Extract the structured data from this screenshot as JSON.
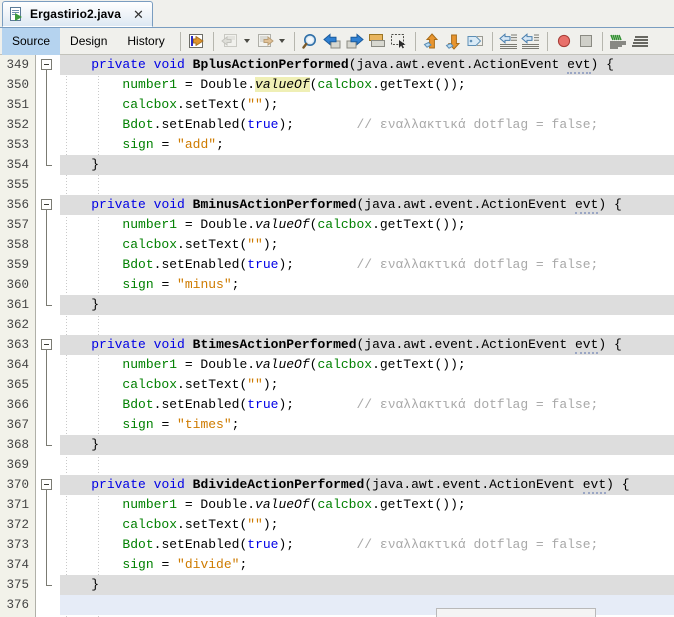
{
  "window": {
    "tab": {
      "title": "Ergastirio2.java",
      "icon": "java-file-icon",
      "close_label": "✕"
    }
  },
  "view_tabs": [
    {
      "label": "Source",
      "selected": true
    },
    {
      "label": "Design",
      "selected": false
    },
    {
      "label": "History",
      "selected": false
    }
  ],
  "toolbar": {
    "groups": [
      {
        "items": [
          {
            "name": "last-edit-icon",
            "kind": "last-edit"
          }
        ]
      },
      {
        "items": [
          {
            "name": "back-icon",
            "kind": "back",
            "disabled": true
          },
          {
            "name": "back-dropdown-icon",
            "kind": "caret"
          },
          {
            "name": "forward-icon",
            "kind": "forward",
            "disabled": true
          },
          {
            "name": "forward-dropdown-icon",
            "kind": "caret"
          }
        ]
      },
      {
        "items": [
          {
            "name": "find-selection-icon",
            "kind": "magnifier"
          },
          {
            "name": "find-previous-icon",
            "kind": "arrow-left-blue"
          },
          {
            "name": "find-next-icon",
            "kind": "arrow-right-blue"
          },
          {
            "name": "toggle-highlight-icon",
            "kind": "highlight"
          },
          {
            "name": "toggle-rectangular-selection-icon",
            "kind": "rect-select"
          }
        ]
      },
      {
        "items": [
          {
            "name": "previous-bookmark-icon",
            "kind": "arrow-up-orange"
          },
          {
            "name": "next-bookmark-icon",
            "kind": "arrow-down-orange"
          },
          {
            "name": "toggle-bookmark-icon",
            "kind": "bookmark-tag"
          }
        ]
      },
      {
        "items": [
          {
            "name": "shift-line-left-icon",
            "kind": "shift-left"
          },
          {
            "name": "shift-line-right-icon",
            "kind": "shift-right"
          }
        ]
      },
      {
        "items": [
          {
            "name": "toggle-breakpoint-icon",
            "kind": "breakpoint-red"
          },
          {
            "name": "stop-icon",
            "kind": "stop-grey"
          }
        ]
      },
      {
        "items": [
          {
            "name": "inspect-members-icon",
            "kind": "members-green"
          },
          {
            "name": "inspect-hierarchy-icon",
            "kind": "hierarchy-dark"
          }
        ]
      }
    ]
  },
  "editor": {
    "first_line": 349,
    "current_line": 376,
    "highlight_token": "valueOf",
    "folds": [
      {
        "start": 349,
        "end": 354
      },
      {
        "start": 356,
        "end": 361
      },
      {
        "start": 363,
        "end": 368
      },
      {
        "start": 370,
        "end": 375
      }
    ],
    "lines": [
      {
        "n": 349,
        "hl": true,
        "cur": false,
        "indent": 4,
        "tokens": [
          {
            "t": "private",
            "c": "kw"
          },
          {
            "t": " ",
            "c": ""
          },
          {
            "t": "void",
            "c": "kw"
          },
          {
            "t": " ",
            "c": ""
          },
          {
            "t": "BplusActionPerformed",
            "c": "bold"
          },
          {
            "t": "(java.awt.event.ActionEvent ",
            "c": ""
          },
          {
            "t": "evt",
            "c": "sq"
          },
          {
            "t": ") {",
            "c": ""
          }
        ]
      },
      {
        "n": 350,
        "hl": false,
        "cur": false,
        "indent": 8,
        "tokens": [
          {
            "t": "number1",
            "c": "id"
          },
          {
            "t": " = ",
            "c": ""
          },
          {
            "t": "Double",
            "c": ""
          },
          {
            "t": ".",
            "c": ""
          },
          {
            "t": "valueOf",
            "c": "mark"
          },
          {
            "t": "(",
            "c": ""
          },
          {
            "t": "calcbox",
            "c": "id"
          },
          {
            "t": ".getText());",
            "c": ""
          }
        ]
      },
      {
        "n": 351,
        "hl": false,
        "cur": false,
        "indent": 8,
        "tokens": [
          {
            "t": "calcbox",
            "c": "id"
          },
          {
            "t": ".setText(",
            "c": ""
          },
          {
            "t": "\"\"",
            "c": "str"
          },
          {
            "t": ");",
            "c": ""
          }
        ]
      },
      {
        "n": 352,
        "hl": false,
        "cur": false,
        "indent": 8,
        "tokens": [
          {
            "t": "Bdot",
            "c": "id"
          },
          {
            "t": ".setEnabled(",
            "c": ""
          },
          {
            "t": "true",
            "c": "kw"
          },
          {
            "t": ");",
            "c": ""
          },
          {
            "t": "        ",
            "c": ""
          },
          {
            "t": "// εναλλακτικά dotflag = false;",
            "c": "cmt"
          }
        ]
      },
      {
        "n": 353,
        "hl": false,
        "cur": false,
        "indent": 8,
        "tokens": [
          {
            "t": "sign",
            "c": "id"
          },
          {
            "t": " = ",
            "c": ""
          },
          {
            "t": "\"add\"",
            "c": "str"
          },
          {
            "t": ";",
            "c": ""
          }
        ]
      },
      {
        "n": 354,
        "hl": true,
        "cur": false,
        "indent": 4,
        "tokens": [
          {
            "t": "}",
            "c": ""
          }
        ]
      },
      {
        "n": 355,
        "hl": false,
        "cur": false,
        "indent": 0,
        "tokens": []
      },
      {
        "n": 356,
        "hl": true,
        "cur": false,
        "indent": 4,
        "tokens": [
          {
            "t": "private",
            "c": "kw"
          },
          {
            "t": " ",
            "c": ""
          },
          {
            "t": "void",
            "c": "kw"
          },
          {
            "t": " ",
            "c": ""
          },
          {
            "t": "BminusActionPerformed",
            "c": "bold"
          },
          {
            "t": "(java.awt.event.ActionEvent ",
            "c": ""
          },
          {
            "t": "evt",
            "c": "sq"
          },
          {
            "t": ") {",
            "c": ""
          }
        ]
      },
      {
        "n": 357,
        "hl": false,
        "cur": false,
        "indent": 8,
        "tokens": [
          {
            "t": "number1",
            "c": "id"
          },
          {
            "t": " = ",
            "c": ""
          },
          {
            "t": "Double",
            "c": ""
          },
          {
            "t": ".",
            "c": ""
          },
          {
            "t": "valueOf",
            "c": "stat"
          },
          {
            "t": "(",
            "c": ""
          },
          {
            "t": "calcbox",
            "c": "id"
          },
          {
            "t": ".getText());",
            "c": ""
          }
        ]
      },
      {
        "n": 358,
        "hl": false,
        "cur": false,
        "indent": 8,
        "tokens": [
          {
            "t": "calcbox",
            "c": "id"
          },
          {
            "t": ".setText(",
            "c": ""
          },
          {
            "t": "\"\"",
            "c": "str"
          },
          {
            "t": ");",
            "c": ""
          }
        ]
      },
      {
        "n": 359,
        "hl": false,
        "cur": false,
        "indent": 8,
        "tokens": [
          {
            "t": "Bdot",
            "c": "id"
          },
          {
            "t": ".setEnabled(",
            "c": ""
          },
          {
            "t": "true",
            "c": "kw"
          },
          {
            "t": ");",
            "c": ""
          },
          {
            "t": "        ",
            "c": ""
          },
          {
            "t": "// εναλλακτικά dotflag = false;",
            "c": "cmt"
          }
        ]
      },
      {
        "n": 360,
        "hl": false,
        "cur": false,
        "indent": 8,
        "tokens": [
          {
            "t": "sign",
            "c": "id"
          },
          {
            "t": " = ",
            "c": ""
          },
          {
            "t": "\"minus\"",
            "c": "str"
          },
          {
            "t": ";",
            "c": ""
          }
        ]
      },
      {
        "n": 361,
        "hl": true,
        "cur": false,
        "indent": 4,
        "tokens": [
          {
            "t": "}",
            "c": ""
          }
        ]
      },
      {
        "n": 362,
        "hl": false,
        "cur": false,
        "indent": 0,
        "tokens": []
      },
      {
        "n": 363,
        "hl": true,
        "cur": false,
        "indent": 4,
        "tokens": [
          {
            "t": "private",
            "c": "kw"
          },
          {
            "t": " ",
            "c": ""
          },
          {
            "t": "void",
            "c": "kw"
          },
          {
            "t": " ",
            "c": ""
          },
          {
            "t": "BtimesActionPerformed",
            "c": "bold"
          },
          {
            "t": "(java.awt.event.ActionEvent ",
            "c": ""
          },
          {
            "t": "evt",
            "c": "sq"
          },
          {
            "t": ") {",
            "c": ""
          }
        ]
      },
      {
        "n": 364,
        "hl": false,
        "cur": false,
        "indent": 8,
        "tokens": [
          {
            "t": "number1",
            "c": "id"
          },
          {
            "t": " = ",
            "c": ""
          },
          {
            "t": "Double",
            "c": ""
          },
          {
            "t": ".",
            "c": ""
          },
          {
            "t": "valueOf",
            "c": "stat"
          },
          {
            "t": "(",
            "c": ""
          },
          {
            "t": "calcbox",
            "c": "id"
          },
          {
            "t": ".getText());",
            "c": ""
          }
        ]
      },
      {
        "n": 365,
        "hl": false,
        "cur": false,
        "indent": 8,
        "tokens": [
          {
            "t": "calcbox",
            "c": "id"
          },
          {
            "t": ".setText(",
            "c": ""
          },
          {
            "t": "\"\"",
            "c": "str"
          },
          {
            "t": ");",
            "c": ""
          }
        ]
      },
      {
        "n": 366,
        "hl": false,
        "cur": false,
        "indent": 8,
        "tokens": [
          {
            "t": "Bdot",
            "c": "id"
          },
          {
            "t": ".setEnabled(",
            "c": ""
          },
          {
            "t": "true",
            "c": "kw"
          },
          {
            "t": ");",
            "c": ""
          },
          {
            "t": "        ",
            "c": ""
          },
          {
            "t": "// εναλλακτικά dotflag = false;",
            "c": "cmt"
          }
        ]
      },
      {
        "n": 367,
        "hl": false,
        "cur": false,
        "indent": 8,
        "tokens": [
          {
            "t": "sign",
            "c": "id"
          },
          {
            "t": " = ",
            "c": ""
          },
          {
            "t": "\"times\"",
            "c": "str"
          },
          {
            "t": ";",
            "c": ""
          }
        ]
      },
      {
        "n": 368,
        "hl": true,
        "cur": false,
        "indent": 4,
        "tokens": [
          {
            "t": "}",
            "c": ""
          }
        ]
      },
      {
        "n": 369,
        "hl": false,
        "cur": false,
        "indent": 0,
        "tokens": []
      },
      {
        "n": 370,
        "hl": true,
        "cur": false,
        "indent": 4,
        "tokens": [
          {
            "t": "private",
            "c": "kw"
          },
          {
            "t": " ",
            "c": ""
          },
          {
            "t": "void",
            "c": "kw"
          },
          {
            "t": " ",
            "c": ""
          },
          {
            "t": "BdivideActionPerformed",
            "c": "bold"
          },
          {
            "t": "(java.awt.event.ActionEvent ",
            "c": ""
          },
          {
            "t": "evt",
            "c": "sq"
          },
          {
            "t": ") {",
            "c": ""
          }
        ]
      },
      {
        "n": 371,
        "hl": false,
        "cur": false,
        "indent": 8,
        "tokens": [
          {
            "t": "number1",
            "c": "id"
          },
          {
            "t": " = ",
            "c": ""
          },
          {
            "t": "Double",
            "c": ""
          },
          {
            "t": ".",
            "c": ""
          },
          {
            "t": "valueOf",
            "c": "stat"
          },
          {
            "t": "(",
            "c": ""
          },
          {
            "t": "calcbox",
            "c": "id"
          },
          {
            "t": ".getText());",
            "c": ""
          }
        ]
      },
      {
        "n": 372,
        "hl": false,
        "cur": false,
        "indent": 8,
        "tokens": [
          {
            "t": "calcbox",
            "c": "id"
          },
          {
            "t": ".setText(",
            "c": ""
          },
          {
            "t": "\"\"",
            "c": "str"
          },
          {
            "t": ");",
            "c": ""
          }
        ]
      },
      {
        "n": 373,
        "hl": false,
        "cur": false,
        "indent": 8,
        "tokens": [
          {
            "t": "Bdot",
            "c": "id"
          },
          {
            "t": ".setEnabled(",
            "c": ""
          },
          {
            "t": "true",
            "c": "kw"
          },
          {
            "t": ");",
            "c": ""
          },
          {
            "t": "        ",
            "c": ""
          },
          {
            "t": "// εναλλακτικά dotflag = false;",
            "c": "cmt"
          }
        ]
      },
      {
        "n": 374,
        "hl": false,
        "cur": false,
        "indent": 8,
        "tokens": [
          {
            "t": "sign",
            "c": "id"
          },
          {
            "t": " = ",
            "c": ""
          },
          {
            "t": "\"divide\"",
            "c": "str"
          },
          {
            "t": ";",
            "c": ""
          }
        ]
      },
      {
        "n": 375,
        "hl": true,
        "cur": false,
        "indent": 4,
        "tokens": [
          {
            "t": "}",
            "c": ""
          }
        ]
      },
      {
        "n": 376,
        "hl": false,
        "cur": true,
        "indent": 0,
        "tokens": []
      }
    ]
  },
  "colors": {
    "keyword": "#0000e6",
    "identifier": "#008000",
    "string": "#ce7b00",
    "comment": "#a8a8a8",
    "line_highlight": "#dddddd",
    "current_line": "#e6ecf7",
    "token_highlight": "#efefb5",
    "selected_tab": "#b5d3ef"
  }
}
